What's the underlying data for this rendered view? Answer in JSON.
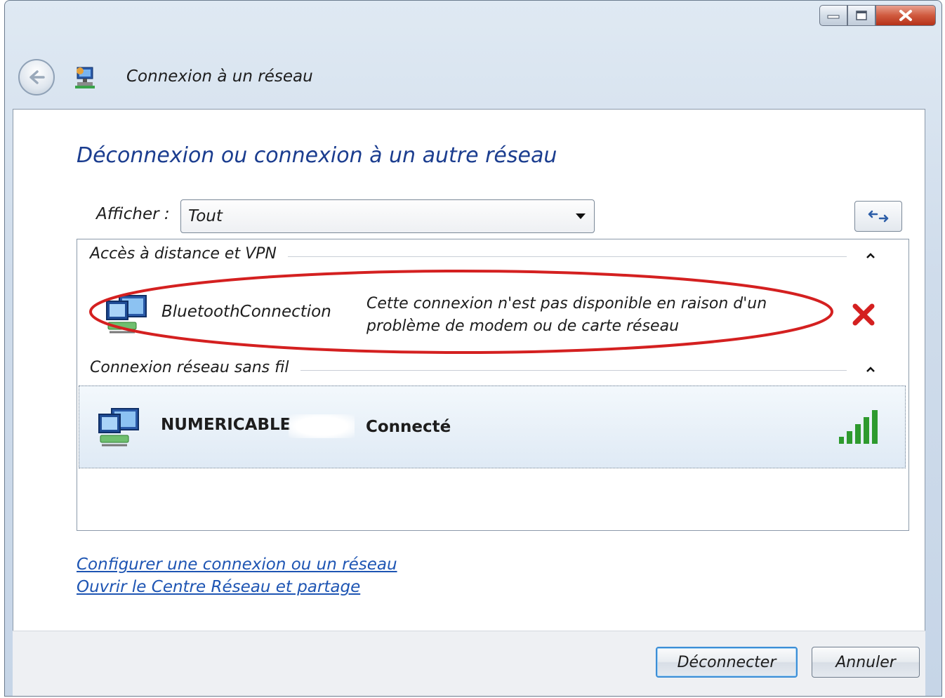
{
  "window": {
    "title": "Connexion à un réseau"
  },
  "main": {
    "heading": "Déconnexion ou connexion à un autre réseau",
    "show_label": "Afficher :",
    "show_value": "Tout"
  },
  "groups": [
    {
      "header": "Accès à distance et VPN",
      "items": [
        {
          "name": "BluetoothConnection",
          "status_line1": "Cette connexion n'est pas disponible en raison d'un",
          "status_line2": "problème de modem ou de carte réseau",
          "state_icon": "red-x-icon"
        }
      ]
    },
    {
      "header": "Connexion réseau sans fil",
      "items": [
        {
          "name": "NUMERICABLE",
          "status": "Connecté",
          "state_icon": "signal-strength-icon",
          "signal_level": 5
        }
      ]
    }
  ],
  "links": {
    "setup": "Configurer une connexion ou un réseau",
    "network_center": "Ouvrir le Centre Réseau et partage"
  },
  "buttons": {
    "disconnect": "Déconnecter",
    "cancel": "Annuler"
  },
  "colors": {
    "heading": "#1b3d8f",
    "link": "#1e55b3",
    "annotation_ellipse": "#d42020",
    "error_x": "#d42020",
    "signal": "#2e9a2e"
  }
}
